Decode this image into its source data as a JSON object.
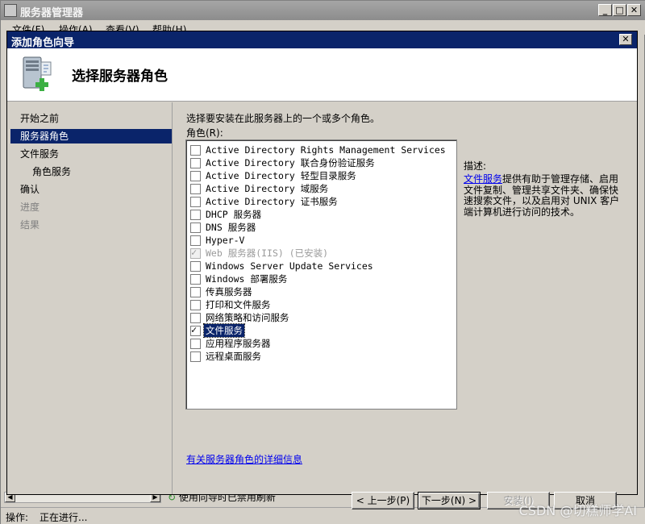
{
  "outer_window": {
    "title": "服务器管理器",
    "menu": [
      "文件(F)",
      "操作(A)",
      "查看(V)",
      "帮助(H)"
    ],
    "status_label": "操作:",
    "status_value": "正在进行...",
    "background_text": "使用向导时已禁用刷新"
  },
  "dialog": {
    "title": "添加角色向导",
    "close_glyph": "✕",
    "header_title": "选择服务器角色",
    "nav": [
      {
        "label": "开始之前",
        "state": "normal"
      },
      {
        "label": "服务器角色",
        "state": "active"
      },
      {
        "label": "文件服务",
        "state": "normal"
      },
      {
        "label": "角色服务",
        "state": "sub"
      },
      {
        "label": "确认",
        "state": "normal"
      },
      {
        "label": "进度",
        "state": "disabled"
      },
      {
        "label": "结果",
        "state": "disabled"
      }
    ],
    "instruction": "选择要安装在此服务器上的一个或多个角色。",
    "roles_label": "角色(R):",
    "roles": [
      {
        "label": "Active Directory Rights Management Services",
        "checked": false,
        "disabled": false
      },
      {
        "label": "Active Directory 联合身份验证服务",
        "checked": false,
        "disabled": false
      },
      {
        "label": "Active Directory 轻型目录服务",
        "checked": false,
        "disabled": false
      },
      {
        "label": "Active Directory 域服务",
        "checked": false,
        "disabled": false
      },
      {
        "label": "Active Directory 证书服务",
        "checked": false,
        "disabled": false
      },
      {
        "label": "DHCP 服务器",
        "checked": false,
        "disabled": false
      },
      {
        "label": "DNS 服务器",
        "checked": false,
        "disabled": false
      },
      {
        "label": "Hyper-V",
        "checked": false,
        "disabled": false
      },
      {
        "label": "Web 服务器(IIS)  (已安装)",
        "checked": true,
        "disabled": true
      },
      {
        "label": "Windows Server Update Services",
        "checked": false,
        "disabled": false
      },
      {
        "label": "Windows 部署服务",
        "checked": false,
        "disabled": false
      },
      {
        "label": "传真服务器",
        "checked": false,
        "disabled": false
      },
      {
        "label": "打印和文件服务",
        "checked": false,
        "disabled": false
      },
      {
        "label": "网络策略和访问服务",
        "checked": false,
        "disabled": false
      },
      {
        "label": "文件服务",
        "checked": true,
        "disabled": false,
        "selected": true
      },
      {
        "label": "应用程序服务器",
        "checked": false,
        "disabled": false
      },
      {
        "label": "远程桌面服务",
        "checked": false,
        "disabled": false
      }
    ],
    "description_label": "描述:",
    "description_link": "文件服务",
    "description_text": "提供有助于管理存储、启用文件复制、管理共享文件夹、确保快速搜索文件，以及启用对 UNIX 客户端计算机进行访问的技术。",
    "more_info_link": "有关服务器角色的详细信息",
    "buttons": {
      "back": "< 上一步(P)",
      "next": "下一步(N) >",
      "install": "安装(I)",
      "cancel": "取消"
    }
  },
  "watermark": "CSDN @切糕师学AI"
}
